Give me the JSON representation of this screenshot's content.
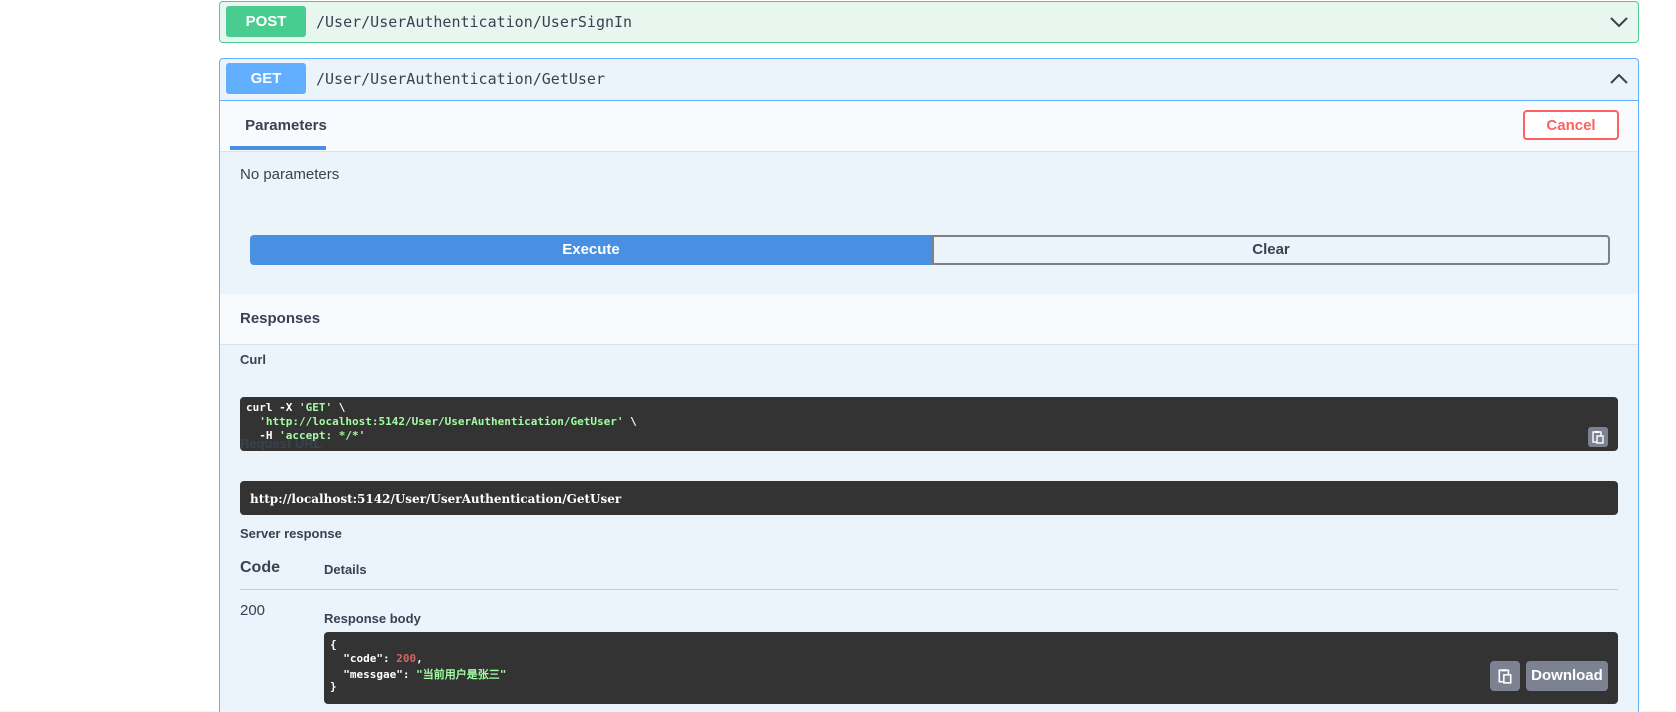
{
  "operations": {
    "post": {
      "method": "POST",
      "path": "/User/UserAuthentication/UserSignIn"
    },
    "get": {
      "method": "GET",
      "path": "/User/UserAuthentication/GetUser"
    }
  },
  "parameters": {
    "tab_label": "Parameters",
    "cancel_label": "Cancel",
    "empty_text": "No parameters"
  },
  "actions": {
    "execute_label": "Execute",
    "clear_label": "Clear"
  },
  "responses": {
    "title": "Responses",
    "curl_label": "Curl",
    "curl_lines": {
      "l1_cmd": "curl -X ",
      "l1_str": "'GET'",
      "l1_end": " \\",
      "l2_str": "  'http://localhost:5142/User/UserAuthentication/GetUser'",
      "l2_end": " \\",
      "l3_cmd": "  -H ",
      "l3_str": "'accept: */*'"
    },
    "request_url_label": "Request URL",
    "request_url": "http://localhost:5142/User/UserAuthentication/GetUser",
    "server_response_label": "Server response",
    "code_header": "Code",
    "details_header": "Details",
    "code_value": "200",
    "response_body_label": "Response body",
    "body": {
      "open": "{",
      "code_key": "  \"code\": ",
      "code_val": "200",
      "code_comma": ",",
      "msg_key": "  \"messgae\": ",
      "msg_val": "\"当前用户是张三\"",
      "close": "}"
    },
    "download_label": "Download"
  },
  "icons": {
    "expand": "chevron-down-icon",
    "collapse": "chevron-up-icon",
    "copy": "copy-to-clipboard-icon"
  },
  "colors": {
    "post": "#49cc90",
    "get": "#61affe",
    "execute": "#4990e2",
    "cancel": "#ff6060",
    "code_bg": "#333333"
  }
}
